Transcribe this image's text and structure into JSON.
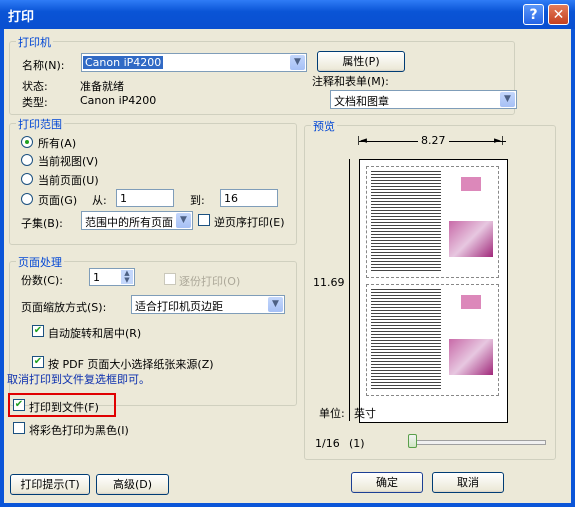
{
  "window": {
    "title": "打印",
    "help_label": "?",
    "close_label": "✕"
  },
  "printer": {
    "group_title": "打印机",
    "name_label": "名称(N):",
    "name_value": "Canon iP4200",
    "properties_button": "属性(P)",
    "status_label": "状态:",
    "status_value": "准备就绪",
    "type_label": "类型:",
    "type_value": "Canon iP4200",
    "comments_label": "注释和表单(M):",
    "comments_value": "文档和图章"
  },
  "range": {
    "group_title": "打印范围",
    "all": "所有(A)",
    "current_view": "当前视图(V)",
    "current_page": "当前页面(U)",
    "pages": "页面(G)",
    "from_label": "从:",
    "from_value": "1",
    "to_label": "到:",
    "to_value": "16",
    "subset_label": "子集(B):",
    "subset_value": "范围中的所有页面",
    "reverse": "逆页序打印(E)"
  },
  "handling": {
    "group_title": "页面处理",
    "copies_label": "份数(C):",
    "copies_value": "1",
    "collate": "逐份打印(O)",
    "scaling_label": "页面缩放方式(S):",
    "scaling_value": "适合打印机页边距",
    "autorotate": "自动旋转和居中(R)",
    "choose_paper": "按 PDF 页面大小选择纸张来源(Z)"
  },
  "hint": "取消打印到文件复选框即可。",
  "print_to_file": "打印到文件(F)",
  "print_black": "将彩色打印为黑色(I)",
  "preview": {
    "group_title": "预览",
    "width": "8.27",
    "height": "11.69",
    "unit_label": "单位:",
    "unit_value": "英寸",
    "page_indicator": "1/16",
    "page_count": "(1)",
    "slider_position": 0
  },
  "footer": {
    "tips_button": "打印提示(T)",
    "advanced_button": "高级(D)",
    "ok_button": "确定",
    "cancel_button": "取消"
  },
  "colors": {
    "title_bar": "#0a54d6",
    "client": "#ece9d8",
    "group_title": "#0046d5",
    "selection": "#316ac5",
    "highlight_box": "#e00000"
  }
}
